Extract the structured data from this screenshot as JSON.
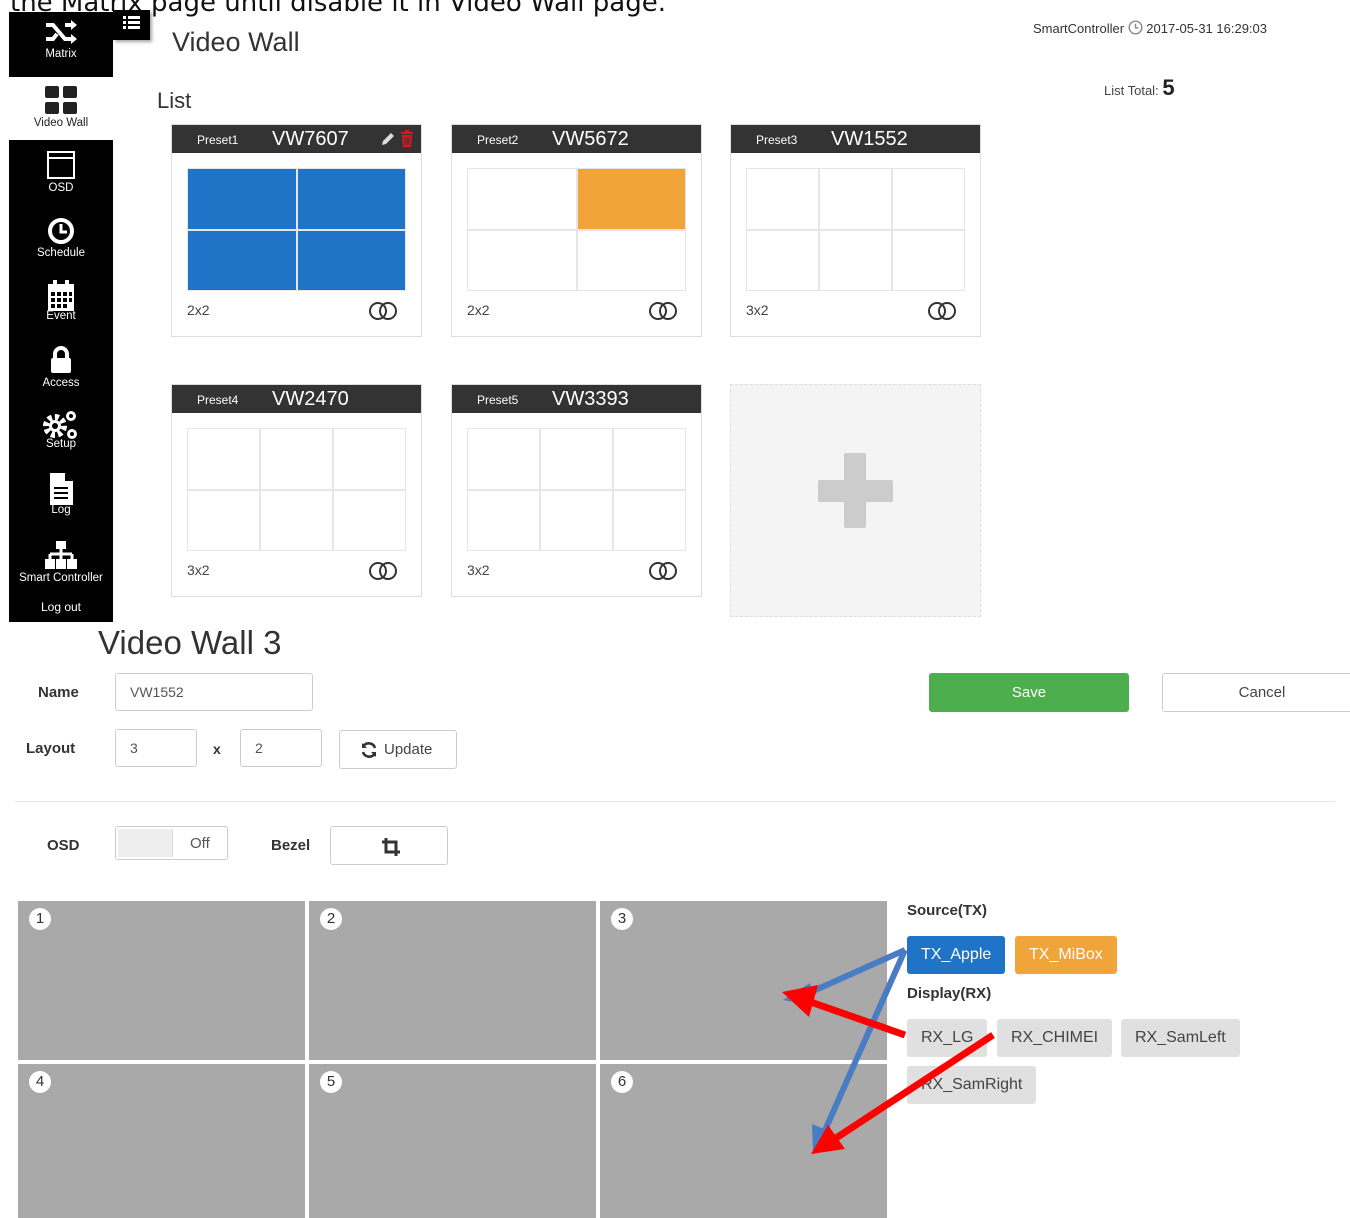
{
  "document": {
    "caption": "the Matrix page until disable it in Video Wall page."
  },
  "sidebar": {
    "items": [
      {
        "label": "Matrix",
        "icon": "shuffle-icon"
      },
      {
        "label": "Video Wall",
        "icon": "grid-icon"
      },
      {
        "label": "OSD",
        "icon": "window-icon"
      },
      {
        "label": "Schedule",
        "icon": "clock-icon"
      },
      {
        "label": "Event",
        "icon": "calendar-icon"
      },
      {
        "label": "Access",
        "icon": "lock-icon"
      },
      {
        "label": "Setup",
        "icon": "gears-icon"
      },
      {
        "label": "Log",
        "icon": "file-icon"
      },
      {
        "label": "Smart Controller",
        "icon": "sitemap-icon"
      }
    ],
    "logout": "Log out",
    "active_index": 1
  },
  "header": {
    "title": "Video Wall",
    "controller": "SmartController",
    "datetime": "2017-05-31 16:29:03"
  },
  "list": {
    "heading": "List",
    "total_label": "List Total:",
    "total": "5",
    "presets": [
      {
        "preset": "Preset1",
        "name": "VW7607",
        "layout": "2x2",
        "cols": 2,
        "rows": 2,
        "fills": [
          "blue",
          "blue",
          "blue",
          "blue"
        ],
        "editable": true
      },
      {
        "preset": "Preset2",
        "name": "VW5672",
        "layout": "2x2",
        "cols": 2,
        "rows": 2,
        "fills": [
          "",
          "orange",
          "",
          ""
        ],
        "editable": false
      },
      {
        "preset": "Preset3",
        "name": "VW1552",
        "layout": "3x2",
        "cols": 3,
        "rows": 2,
        "fills": [
          "",
          "",
          "",
          "",
          "",
          ""
        ],
        "editable": false
      },
      {
        "preset": "Preset4",
        "name": "VW2470",
        "layout": "3x2",
        "cols": 3,
        "rows": 2,
        "fills": [
          "",
          "",
          "",
          "",
          "",
          ""
        ],
        "editable": false
      },
      {
        "preset": "Preset5",
        "name": "VW3393",
        "layout": "3x2",
        "cols": 3,
        "rows": 2,
        "fills": [
          "",
          "",
          "",
          "",
          "",
          ""
        ],
        "editable": false
      }
    ]
  },
  "editor": {
    "title": "Video Wall 3",
    "name_label": "Name",
    "name_value": "VW1552",
    "layout_label": "Layout",
    "layout_cols": "3",
    "layout_x": "x",
    "layout_rows": "2",
    "update_label": "Update",
    "save_label": "Save",
    "cancel_label": "Cancel",
    "osd_label": "OSD",
    "osd_state": "Off",
    "bezel_label": "Bezel",
    "screens": [
      "1",
      "2",
      "3",
      "4",
      "5",
      "6"
    ],
    "source_label": "Source(TX)",
    "sources": [
      {
        "label": "TX_Apple",
        "color": "#1f74c8"
      },
      {
        "label": "TX_MiBox",
        "color": "#f0a43a"
      }
    ],
    "display_label": "Display(RX)",
    "displays": [
      "RX_LG",
      "RX_CHIMEI",
      "RX_SamLeft",
      "RX_SamRight"
    ]
  },
  "colors": {
    "sidebar_bg": "#000000",
    "save_green": "#4cae4c",
    "annotation_blue": "#4a7cc4",
    "annotation_red": "#ff0000"
  }
}
